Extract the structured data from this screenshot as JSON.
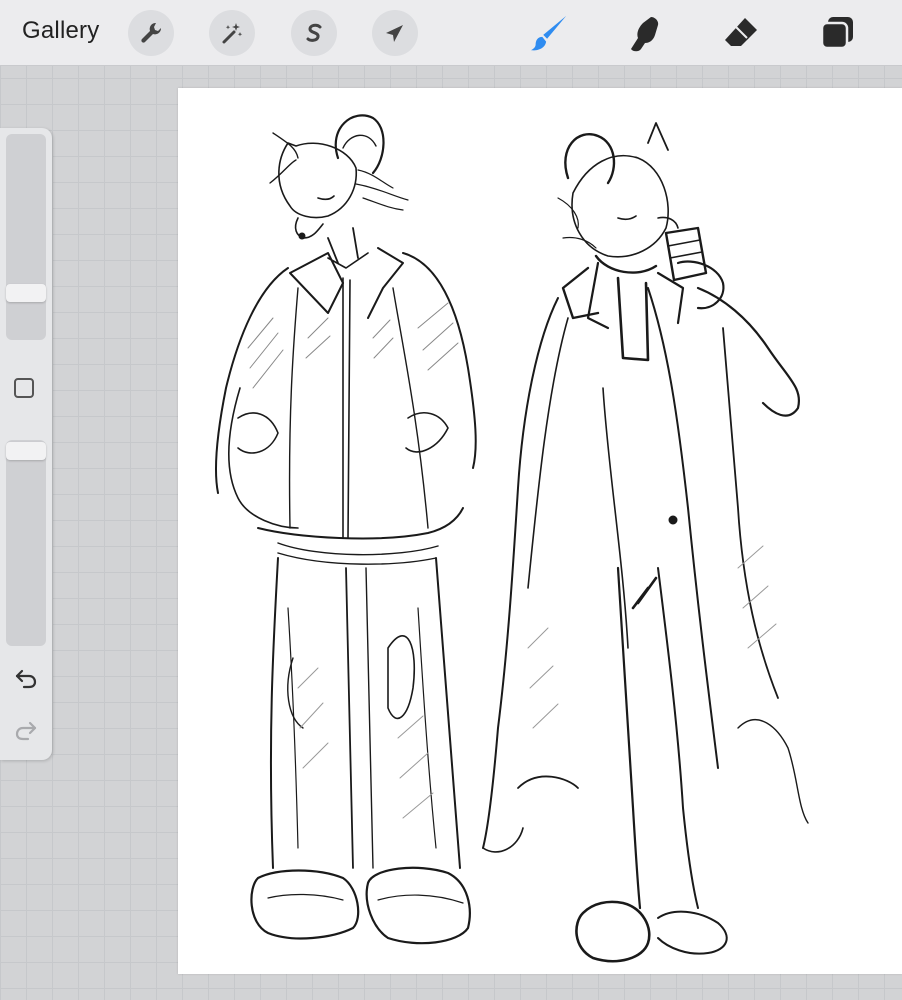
{
  "toolbar": {
    "gallery_label": "Gallery",
    "left_tools": [
      {
        "icon": "wrench-icon",
        "name": "actions"
      },
      {
        "icon": "magic-wand-icon",
        "name": "adjustments"
      },
      {
        "icon": "selection-s-icon",
        "name": "selection"
      },
      {
        "icon": "arrow-cursor-icon",
        "name": "transform"
      }
    ],
    "right_tools": [
      {
        "icon": "brush-icon",
        "name": "paint",
        "active": true
      },
      {
        "icon": "smudge-icon",
        "name": "smudge",
        "active": false
      },
      {
        "icon": "eraser-icon",
        "name": "erase",
        "active": false
      },
      {
        "icon": "layers-icon",
        "name": "layers",
        "active": false
      }
    ],
    "active_color": "#2f8cf0"
  },
  "sidebar": {
    "brush_size_level": 0.3,
    "opacity_level": 0.0,
    "undo_icon": "undo-icon",
    "redo_icon": "redo-icon",
    "modify_icon": "modify-square-icon"
  },
  "canvas": {
    "content": "two-character-sketch",
    "background": "#ffffff"
  }
}
